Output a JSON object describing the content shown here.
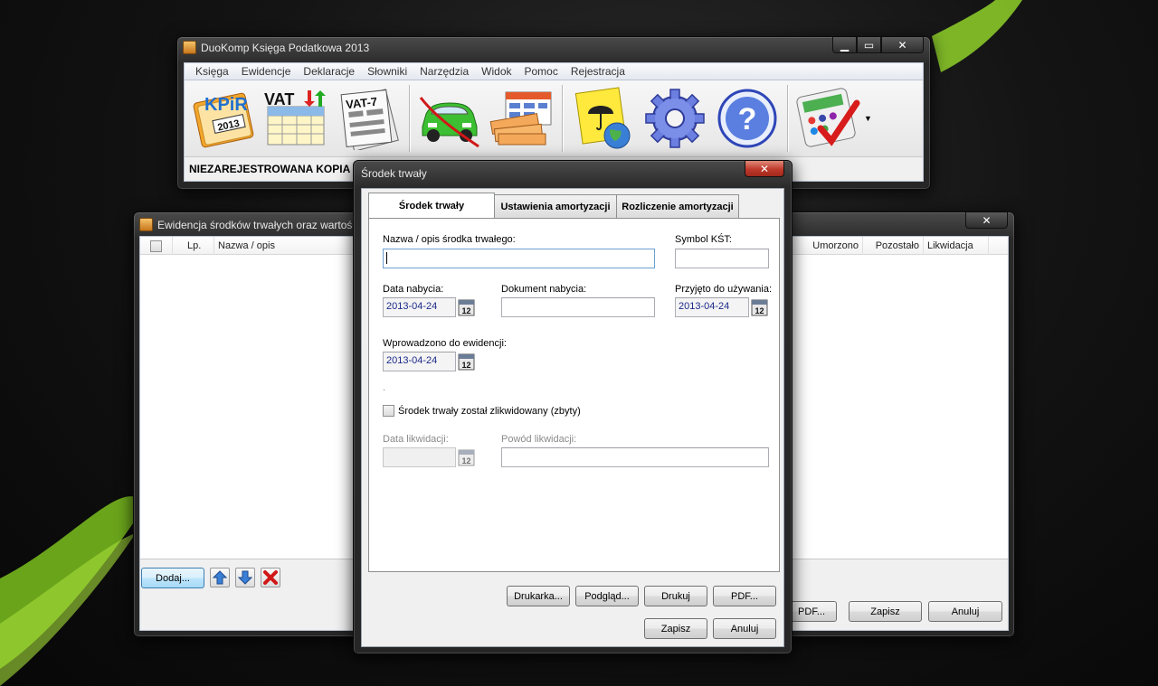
{
  "main_window": {
    "title": "DuoKomp Księga Podatkowa 2013",
    "menu": [
      "Księga",
      "Ewidencje",
      "Deklaracje",
      "Słowniki",
      "Narzędzia",
      "Widok",
      "Pomoc",
      "Rejestracja"
    ],
    "toolbar_icons": [
      "kpir-icon",
      "vat-icon",
      "vat7-icon",
      "car-icon",
      "money-icon",
      "umbrella-globe-icon",
      "settings-gear-icon",
      "help-icon",
      "calculator-icon"
    ],
    "kpir_label": "KPiR",
    "kpir_year": "2013",
    "vat_label": "VAT",
    "vat7_label": "VAT-7",
    "help_symbol": "?",
    "status_text": "NIEZAREJESTROWANA KOPIA W T"
  },
  "list_window": {
    "title": "Ewidencja środków trwałych oraz wartości",
    "columns_left": [
      "Lp.",
      "Nazwa / opis"
    ],
    "columns_right": [
      "Umorzono",
      "Pozostało",
      "Likwidacja"
    ],
    "buttons": {
      "add": "Dodaj...",
      "pdf": "PDF...",
      "save": "Zapisz",
      "cancel": "Anuluj"
    }
  },
  "dialog": {
    "title": "Środek trwały",
    "tabs": [
      "Środek trwały",
      "Ustawienia amortyzacji",
      "Rozliczenie amortyzacji"
    ],
    "fields": {
      "name_label": "Nazwa / opis środka trwałego:",
      "name_value": "",
      "kst_label": "Symbol KŚT:",
      "kst_value": "",
      "purchase_date_label": "Data nabycia:",
      "purchase_date_value": "2013-04-24",
      "purchase_doc_label": "Dokument nabycia:",
      "purchase_doc_value": "",
      "in_use_label": "Przyjęto do używania:",
      "in_use_value": "2013-04-24",
      "entered_label": "Wprowadzono do ewidencji:",
      "entered_value": "2013-04-24",
      "dot": ".",
      "liquidated_label": "Środek trwały został zlikwidowany (zbyty)",
      "liquidated_checked": false,
      "liq_date_label": "Data likwidacji:",
      "liq_date_value": "",
      "liq_reason_label": "Powód likwidacji:",
      "liq_reason_value": "",
      "calendar_day": "12"
    },
    "buttons": {
      "printer": "Drukarka...",
      "preview": "Podgląd...",
      "print": "Drukuj",
      "pdf": "PDF...",
      "save": "Zapisz",
      "cancel": "Anuluj"
    }
  }
}
